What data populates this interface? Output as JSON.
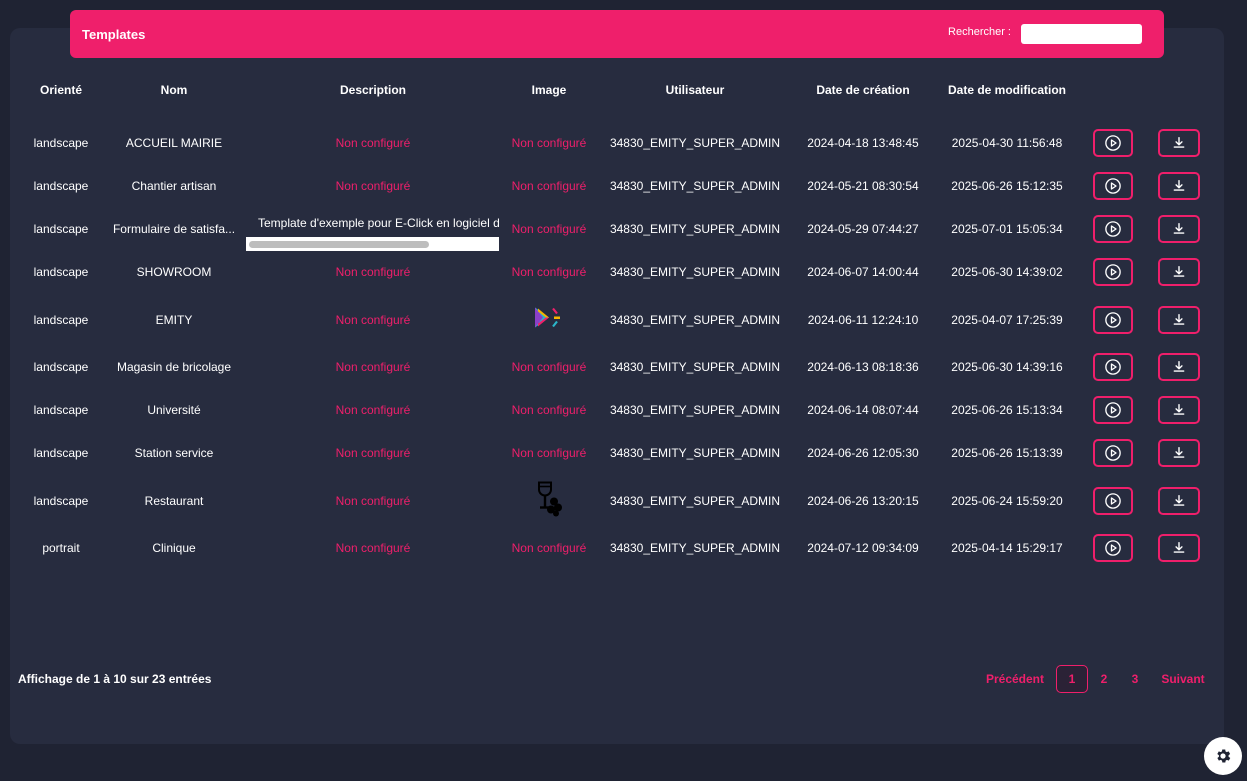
{
  "header": {
    "title": "Templates",
    "search_label": "Rechercher :",
    "search_value": ""
  },
  "columns": [
    "Orienté",
    "Nom",
    "Description",
    "Image",
    "Utilisateur",
    "Date de création",
    "Date de modification"
  ],
  "rows": [
    {
      "orientation": "landscape",
      "name": "ACCUEIL MAIRIE",
      "description": "Non configuré",
      "image": "Non configuré",
      "user": "34830_EMITY_SUPER_ADMIN",
      "created": "2024-04-18 13:48:45",
      "modified": "2025-04-30 11:56:48"
    },
    {
      "orientation": "landscape",
      "name": "Chantier artisan",
      "description": "Non configuré",
      "image": "Non configuré",
      "user": "34830_EMITY_SUPER_ADMIN",
      "created": "2024-05-21 08:30:54",
      "modified": "2025-06-26 15:12:35"
    },
    {
      "orientation": "landscape",
      "name": "Formulaire de satisfa...",
      "description": "Template d'exemple pour E-Click en logiciel d",
      "image": "Non configuré",
      "user": "34830_EMITY_SUPER_ADMIN",
      "created": "2024-05-29 07:44:27",
      "modified": "2025-07-01 15:05:34"
    },
    {
      "orientation": "landscape",
      "name": "SHOWROOM",
      "description": "Non configuré",
      "image": "Non configuré",
      "user": "34830_EMITY_SUPER_ADMIN",
      "created": "2024-06-07 14:00:44",
      "modified": "2025-06-30 14:39:02"
    },
    {
      "orientation": "landscape",
      "name": "EMITY",
      "description": "Non configuré",
      "image": "emity-logo-icon",
      "user": "34830_EMITY_SUPER_ADMIN",
      "created": "2024-06-11 12:24:10",
      "modified": "2025-04-07 17:25:39"
    },
    {
      "orientation": "landscape",
      "name": "Magasin de bricolage",
      "description": "Non configuré",
      "image": "Non configuré",
      "user": "34830_EMITY_SUPER_ADMIN",
      "created": "2024-06-13 08:18:36",
      "modified": "2025-06-30 14:39:16"
    },
    {
      "orientation": "landscape",
      "name": "Université",
      "description": "Non configuré",
      "image": "Non configuré",
      "user": "34830_EMITY_SUPER_ADMIN",
      "created": "2024-06-14 08:07:44",
      "modified": "2025-06-26 15:13:34"
    },
    {
      "orientation": "landscape",
      "name": "Station service",
      "description": "Non configuré",
      "image": "Non configuré",
      "user": "34830_EMITY_SUPER_ADMIN",
      "created": "2024-06-26 12:05:30",
      "modified": "2025-06-26 15:13:39"
    },
    {
      "orientation": "landscape",
      "name": "Restaurant",
      "description": "Non configuré",
      "image": "wine-glass-icon",
      "user": "34830_EMITY_SUPER_ADMIN",
      "created": "2024-06-26 13:20:15",
      "modified": "2025-06-24 15:59:20"
    },
    {
      "orientation": "portrait",
      "name": "Clinique",
      "description": "Non configuré",
      "image": "Non configuré",
      "user": "34830_EMITY_SUPER_ADMIN",
      "created": "2024-07-12 09:34:09",
      "modified": "2025-04-14 15:29:17"
    }
  ],
  "footer": {
    "info": "Affichage de 1 à 10 sur 23 entrées",
    "prev": "Précédent",
    "pages": [
      "1",
      "2",
      "3"
    ],
    "current_page": "1",
    "next": "Suivant"
  },
  "colors": {
    "accent": "#ef1f6b",
    "background": "#1f2333",
    "panel": "#272c3f"
  },
  "icons": {
    "play": "play-icon",
    "download": "download-icon",
    "settings": "gear-icon"
  }
}
